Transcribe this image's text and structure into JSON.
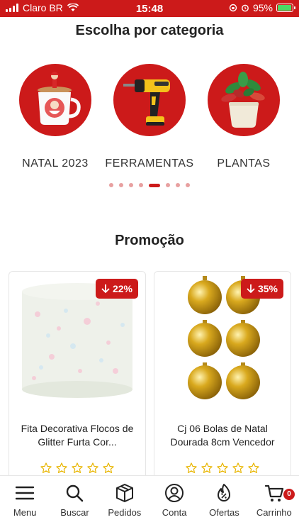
{
  "status_bar": {
    "carrier": "Claro BR",
    "time": "15:48",
    "battery": "95%"
  },
  "categories_section": {
    "title": "Escolha por categoria",
    "items": [
      {
        "label": "NATAL 2023",
        "icon": "christmas-mug-icon"
      },
      {
        "label": "FERRAMENTAS",
        "icon": "drill-icon"
      },
      {
        "label": "PLANTAS",
        "icon": "potted-plant-icon"
      }
    ],
    "carousel_pages": 8,
    "carousel_active_page": 5
  },
  "promo_section": {
    "title": "Promoção",
    "products": [
      {
        "discount": "22%",
        "name": "Fita Decorativa Flocos de Glitter Furta Cor...",
        "rating": 0
      },
      {
        "discount": "35%",
        "name": "Cj 06 Bolas de Natal Dourada 8cm Vencedor",
        "rating": 0
      }
    ]
  },
  "bottom_nav": {
    "items": [
      {
        "label": "Menu",
        "icon": "menu-icon"
      },
      {
        "label": "Buscar",
        "icon": "search-icon"
      },
      {
        "label": "Pedidos",
        "icon": "package-icon"
      },
      {
        "label": "Conta",
        "icon": "user-icon"
      },
      {
        "label": "Ofertas",
        "icon": "flame-percent-icon"
      },
      {
        "label": "Carrinho",
        "icon": "cart-icon"
      }
    ],
    "cart_count": "0"
  },
  "colors": {
    "brand": "#cc1a1a",
    "dot_inactive": "#e8a0a0",
    "star_outline": "#e8b500"
  }
}
